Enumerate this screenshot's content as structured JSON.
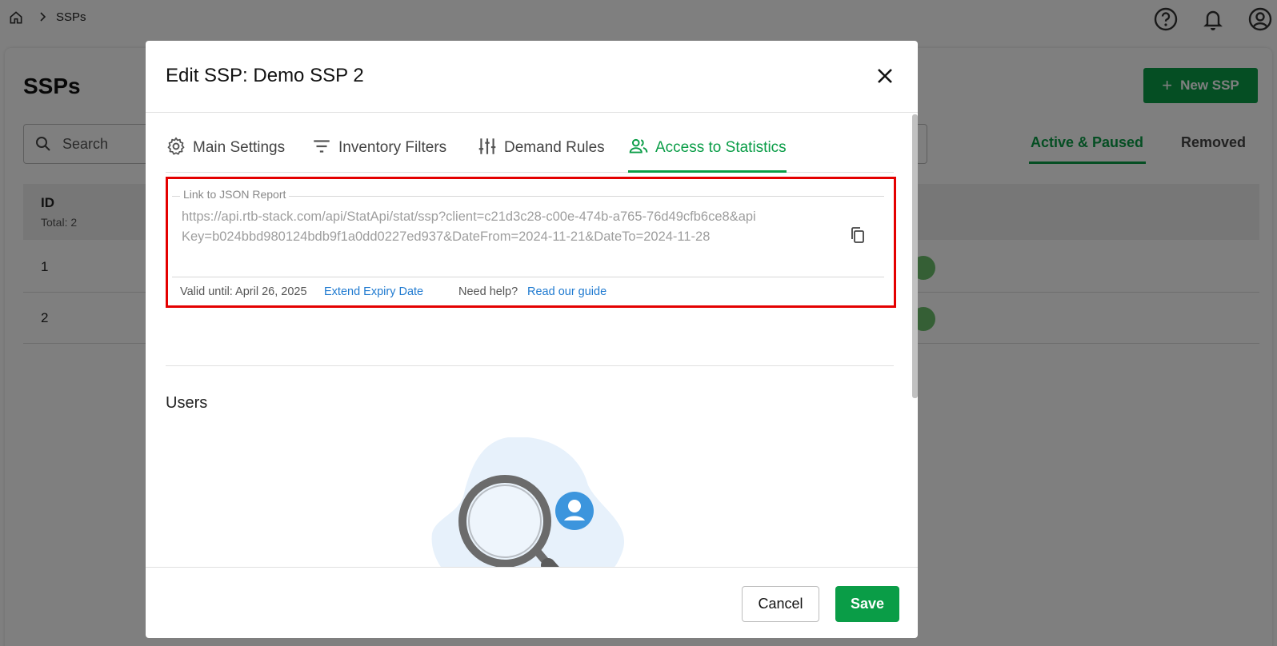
{
  "breadcrumb": {
    "home_icon": "home-icon",
    "current": "SSPs"
  },
  "topbar_icons": [
    "help-icon",
    "bell-icon",
    "account-icon"
  ],
  "page": {
    "title": "SSPs",
    "new_button": "New SSP",
    "search_placeholder": "Search",
    "status_tabs": [
      {
        "label": "Active & Paused",
        "active": true
      },
      {
        "label": "Removed",
        "active": false
      }
    ],
    "table": {
      "id_header": "ID",
      "total": "Total: 2",
      "rows": [
        "1",
        "2"
      ]
    }
  },
  "modal": {
    "title": "Edit SSP: Demo SSP 2",
    "tabs": [
      {
        "label": "Main Settings",
        "icon": "gear-icon",
        "active": false
      },
      {
        "label": "Inventory Filters",
        "icon": "filter-icon",
        "active": false
      },
      {
        "label": "Demand Rules",
        "icon": "sliders-icon",
        "active": false
      },
      {
        "label": "Access to Statistics",
        "icon": "users-icon",
        "active": true
      }
    ],
    "report": {
      "legend": "Link to JSON Report",
      "url": "https://api.rtb-stack.com/api/StatApi/stat/ssp?client=c21d3c28-c00e-474b-a765-76d49cfb6ce8&apiKey=b024bbd980124bdb9f1a0dd0227ed937&DateFrom=2024-11-21&DateTo=2024-11-28",
      "valid_until": "Valid until: April 26, 2025",
      "extend_link": "Extend Expiry Date",
      "help_text": "Need help?",
      "guide_link": "Read our guide"
    },
    "users_title": "Users",
    "cancel": "Cancel",
    "save": "Save"
  },
  "colors": {
    "accent": "#0a9d47",
    "link": "#1f7ad0",
    "highlight": "#e40000"
  }
}
